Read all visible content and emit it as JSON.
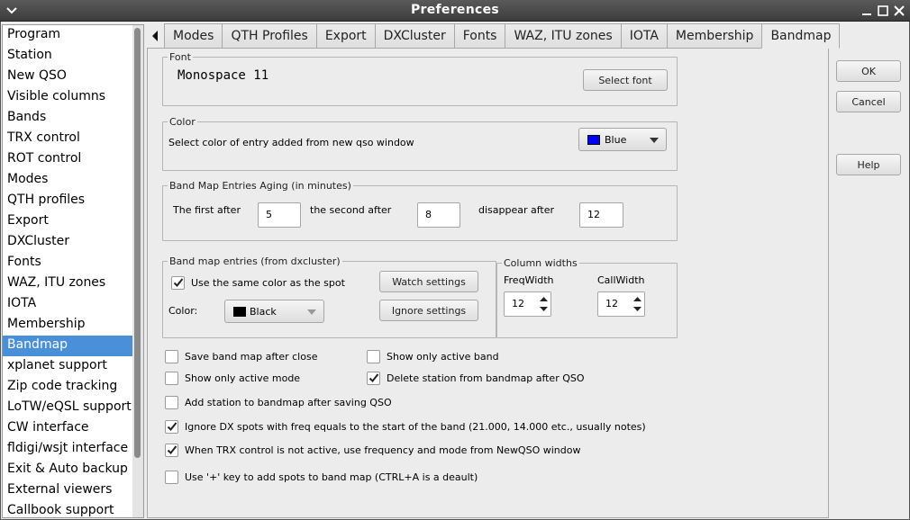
{
  "window": {
    "title": "Preferences"
  },
  "sidebar": {
    "items": [
      {
        "label": "Program"
      },
      {
        "label": "Station"
      },
      {
        "label": "New QSO"
      },
      {
        "label": "Visible columns"
      },
      {
        "label": "Bands"
      },
      {
        "label": "TRX control"
      },
      {
        "label": "ROT control"
      },
      {
        "label": "Modes"
      },
      {
        "label": "QTH profiles"
      },
      {
        "label": "Export"
      },
      {
        "label": "DXCluster"
      },
      {
        "label": "Fonts"
      },
      {
        "label": "WAZ, ITU zones"
      },
      {
        "label": "IOTA"
      },
      {
        "label": "Membership"
      },
      {
        "label": "Bandmap"
      },
      {
        "label": "xplanet support"
      },
      {
        "label": "Zip code tracking"
      },
      {
        "label": "LoTW/eQSL support"
      },
      {
        "label": "CW interface"
      },
      {
        "label": "fldigi/wsjt interface"
      },
      {
        "label": "Exit & Auto backup"
      },
      {
        "label": "External viewers"
      },
      {
        "label": "Callbook support"
      }
    ],
    "selected_index": 15
  },
  "tabs": {
    "items": [
      {
        "label": "Modes"
      },
      {
        "label": "QTH Profiles"
      },
      {
        "label": "Export"
      },
      {
        "label": "DXCluster"
      },
      {
        "label": "Fonts"
      },
      {
        "label": "WAZ, ITU zones"
      },
      {
        "label": "IOTA"
      },
      {
        "label": "Membership"
      },
      {
        "label": "Bandmap"
      }
    ],
    "active_index": 8
  },
  "font_group": {
    "legend": "Font",
    "font_name": "Monospace 11",
    "select_font_label": "Select font"
  },
  "color_group": {
    "legend": "Color",
    "description": "Select color of entry added from new qso window",
    "color_value": "Blue",
    "color_swatch": "#0000ff"
  },
  "aging_group": {
    "legend": "Band Map Entries Aging (in minutes)",
    "first_label": "The first after",
    "first_value": "5",
    "second_label": "the second after",
    "second_value": "8",
    "disappear_label": "disappear after",
    "disappear_value": "12"
  },
  "entries_group": {
    "legend": "Band map entries (from dxcluster)",
    "same_color_label": "Use the same color as the spot",
    "same_color_checked": true,
    "color_label": "Color:",
    "color_value": "Black",
    "color_swatch": "#000000",
    "watch_label": "Watch settings",
    "ignore_label": "Ignore settings"
  },
  "column_widths": {
    "legend": "Column widths",
    "freq_label": "FreqWidth",
    "freq_value": "12",
    "call_label": "CallWidth",
    "call_value": "12"
  },
  "options": {
    "save_after_close": {
      "label": "Save band map after close",
      "checked": false
    },
    "only_active_band": {
      "label": "Show only active band",
      "checked": false
    },
    "only_active_mode": {
      "label": "Show only active mode",
      "checked": false
    },
    "delete_after_qso": {
      "label": "Delete station from bandmap after QSO",
      "checked": true
    },
    "add_after_saving": {
      "label": "Add station to bandmap after saving QSO",
      "checked": false
    },
    "ignore_band_start": {
      "label": "Ignore DX spots with freq equals to the start of the band (21.000, 14.000 etc., usually notes)",
      "checked": true
    },
    "use_newqso_freq": {
      "label": "When TRX control is not active, use frequency and mode from NewQSO window",
      "checked": true
    },
    "plus_key": {
      "label": "Use '+' key to add spots to band map (CTRL+A is a deault)",
      "checked": false
    }
  },
  "dialog_buttons": {
    "ok": "OK",
    "cancel": "Cancel",
    "help": "Help"
  }
}
